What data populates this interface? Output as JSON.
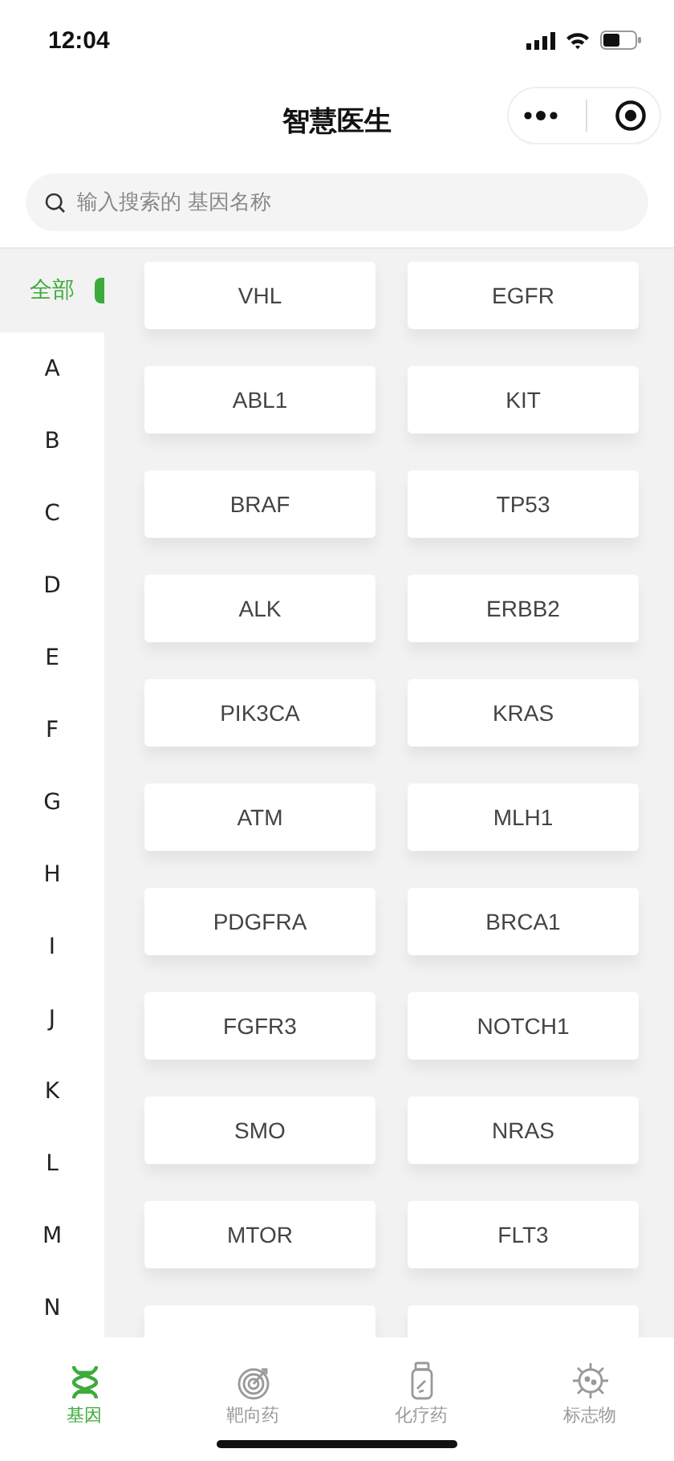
{
  "status_bar": {
    "time": "12:04"
  },
  "nav": {
    "title": "智慧医生"
  },
  "search": {
    "placeholder": "输入搜索的 基因名称"
  },
  "sidebar": {
    "items": [
      {
        "label": "全部",
        "selected": true
      },
      {
        "label": "A",
        "selected": false
      },
      {
        "label": "B",
        "selected": false
      },
      {
        "label": "C",
        "selected": false
      },
      {
        "label": "D",
        "selected": false
      },
      {
        "label": "E",
        "selected": false
      },
      {
        "label": "F",
        "selected": false
      },
      {
        "label": "G",
        "selected": false
      },
      {
        "label": "H",
        "selected": false
      },
      {
        "label": "I",
        "selected": false
      },
      {
        "label": "J",
        "selected": false
      },
      {
        "label": "K",
        "selected": false
      },
      {
        "label": "L",
        "selected": false
      },
      {
        "label": "M",
        "selected": false
      },
      {
        "label": "N",
        "selected": false
      }
    ]
  },
  "genes": [
    "VHL",
    "EGFR",
    "ABL1",
    "KIT",
    "BRAF",
    "TP53",
    "ALK",
    "ERBB2",
    "PIK3CA",
    "KRAS",
    "ATM",
    "MLH1",
    "PDGFRA",
    "BRCA1",
    "FGFR3",
    "NOTCH1",
    "SMO",
    "NRAS",
    "MTOR",
    "FLT3"
  ],
  "tab_bar": [
    {
      "label": "基因",
      "kind": "dna",
      "selected": true
    },
    {
      "label": "靶向药",
      "kind": "target",
      "selected": false
    },
    {
      "label": "化疗药",
      "kind": "bottle",
      "selected": false
    },
    {
      "label": "标志物",
      "kind": "virus",
      "selected": false
    }
  ]
}
